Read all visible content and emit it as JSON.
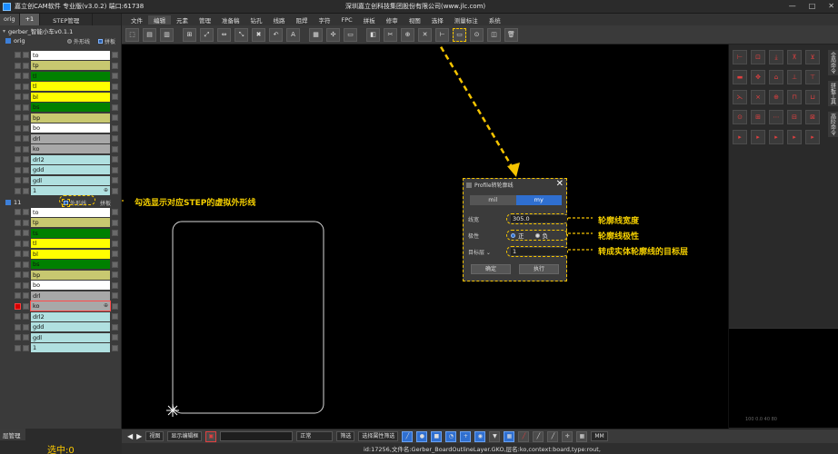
{
  "window": {
    "app_title": "嘉立创CAM软件 专业版(v3.0.2) 端口:61738",
    "company": "深圳嘉立创科技集团股份有限公司(www.jlc.com)",
    "controls": [
      "—",
      "□",
      "✕"
    ]
  },
  "left_panel": {
    "tabs": [
      "orig",
      "+1",
      "STEP管理"
    ],
    "gerber_name": "gerber_智能小车v0.1.1",
    "orig_step": {
      "name": "orig",
      "outline_label": "外形线",
      "panel_label": "拼板",
      "layers": [
        {
          "name": "to",
          "color": "#ffffff"
        },
        {
          "name": "tp",
          "color": "#c8c870"
        },
        {
          "name": "tl",
          "color": "#008000"
        },
        {
          "name": "tl",
          "color": "#ffff00"
        },
        {
          "name": "bl",
          "color": "#ffff00"
        },
        {
          "name": "bs",
          "color": "#008000"
        },
        {
          "name": "bp",
          "color": "#c8c870"
        },
        {
          "name": "bo",
          "color": "#ffffff"
        },
        {
          "name": "drl",
          "color": "#a8a8a8"
        },
        {
          "name": "ko",
          "color": "#a8a8a8"
        },
        {
          "name": "drl2",
          "color": "#b0e0e0"
        },
        {
          "name": "gdd",
          "color": "#b0e0e0"
        },
        {
          "name": "gdl",
          "color": "#b0e0e0"
        },
        {
          "name": "1",
          "color": "#b0e0e0",
          "mark": "⊕"
        }
      ]
    },
    "step_11": {
      "name": "11",
      "outline_label": "外形线",
      "panel_label": "拼板",
      "layers": [
        {
          "name": "to",
          "color": "#ffffff"
        },
        {
          "name": "tp",
          "color": "#c8c870"
        },
        {
          "name": "ts",
          "color": "#008000"
        },
        {
          "name": "tl",
          "color": "#ffff00"
        },
        {
          "name": "bl",
          "color": "#ffff00"
        },
        {
          "name": "bs",
          "color": "#008000"
        },
        {
          "name": "bp",
          "color": "#c8c870"
        },
        {
          "name": "bo",
          "color": "#ffffff"
        },
        {
          "name": "drl",
          "color": "#a8a8a8"
        },
        {
          "name": "ko",
          "color": "#a8a8a8",
          "selected": true,
          "mark": "⊕"
        },
        {
          "name": "drl2",
          "color": "#b0e0e0"
        },
        {
          "name": "gdd",
          "color": "#b0e0e0"
        },
        {
          "name": "gdl",
          "color": "#b0e0e0"
        },
        {
          "name": "1",
          "color": "#b0e0e0"
        }
      ]
    },
    "layer_manager": "层管理",
    "selection_count": "选中:0"
  },
  "menu": [
    "文件",
    "编辑",
    "元素",
    "管理",
    "准备稿",
    "钻孔",
    "线路",
    "阻焊",
    "字符",
    "FPC",
    "拼板",
    "修审",
    "视图",
    "选择",
    "测量标注",
    "系统"
  ],
  "toolbar_icons": [
    "select-icon",
    "layer-icon",
    "copy-icon",
    "move-icon",
    "rotate-icon",
    "mirror-icon",
    "scale-icon",
    "delete-icon",
    "undo-icon",
    "text-icon",
    "grid-icon",
    "snap-icon",
    "profile-icon",
    "fill-icon",
    "cut-icon",
    "join-icon",
    "break-icon",
    "measure-icon",
    "profile-line-icon",
    "drill-icon",
    "pad-icon",
    "trash-icon"
  ],
  "right_panel": {
    "tabs": [
      "全局命令",
      "拼板工具",
      "高阶命令"
    ],
    "tick_labels": "100 0.0  40  80"
  },
  "bottom_bar": {
    "view_mode": "视图",
    "display_editor": "显示编辑框",
    "polarity": "正常",
    "filter": "筛选",
    "select_filter": "选择属性筛选",
    "unit": "MM"
  },
  "status": "id:17256,文件名:Gerber_BoardOutlineLayer.GKO,层名:ko,context:board,type:rout,",
  "dialog": {
    "title": "Profile转轮廓线",
    "units": [
      "mil",
      "my"
    ],
    "width_label": "线宽",
    "width_value": "305.0",
    "polarity_label": "极性",
    "polarity_positive": "正",
    "polarity_negative": "负",
    "target_label": "目标层 ⌄",
    "target_value": "1",
    "ok_button": "确定",
    "apply_button": "执行"
  },
  "annotations": {
    "outline": "勾选显示对应STEP的虚拟外形线",
    "width": "轮廓线宽度",
    "polarity": "轮廓线极性",
    "target": "转成实体轮廓线的目标层"
  },
  "colors": {
    "accent": "#f5c400",
    "brand_blue": "#2f6fd0",
    "outline_stroke": "#d8d8d8",
    "selected_red": "#d40000"
  }
}
